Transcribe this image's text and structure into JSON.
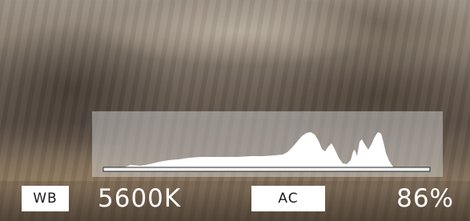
{
  "white_balance": {
    "label": "WB",
    "value": "5600K"
  },
  "ac": {
    "label": "AC",
    "value": "86%"
  },
  "histogram": {
    "fill_color": "#ffffff",
    "panel_color": "rgba(215,215,215,0.48)"
  }
}
